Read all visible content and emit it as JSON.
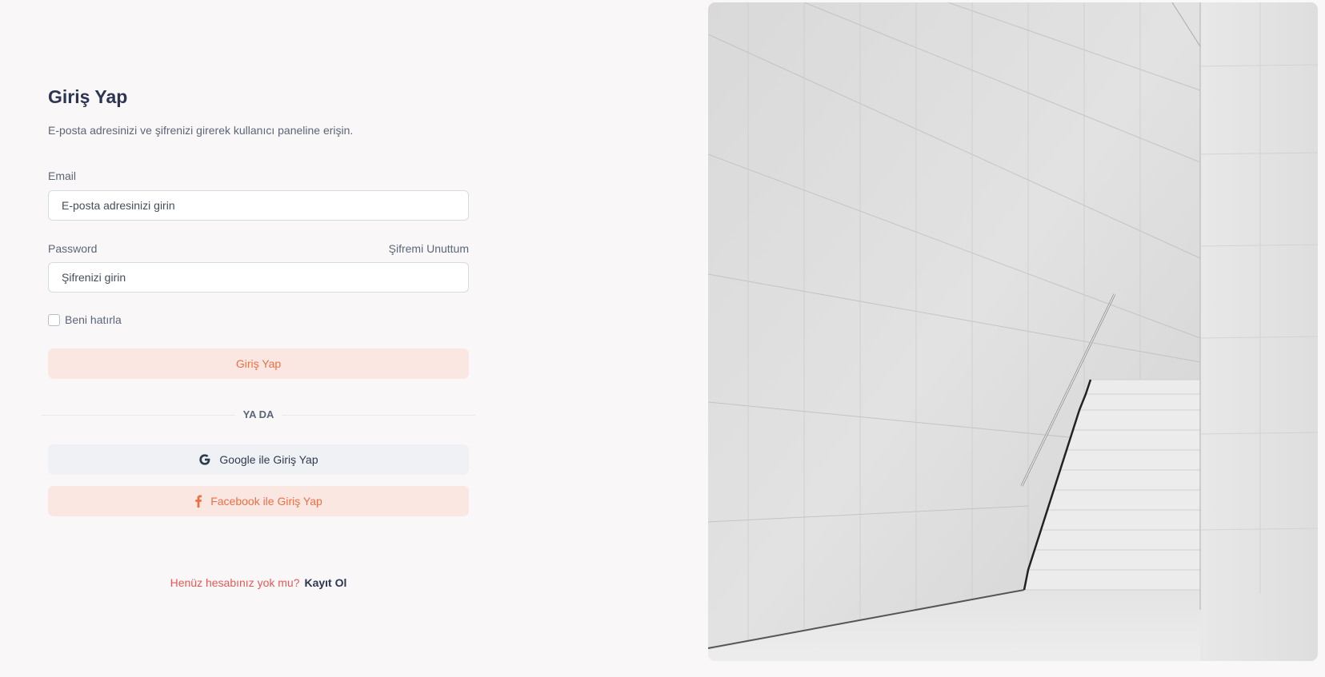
{
  "login": {
    "title": "Giriş Yap",
    "subtitle": "E-posta adresinizi ve şifrenizi girerek kullanıcı paneline erişin.",
    "email": {
      "label": "Email",
      "placeholder": "E-posta adresinizi girin",
      "value": ""
    },
    "password": {
      "label": "Password",
      "placeholder": "Şifrenizi girin",
      "value": "",
      "forgot_label": "Şifremi Unuttum"
    },
    "remember_label": "Beni hatırla",
    "remember_checked": false,
    "submit_label": "Giriş Yap",
    "divider_text": "YA DA",
    "google_label": "Google ile Giriş Yap",
    "facebook_label": "Facebook ile Giriş Yap",
    "signup_question": "Henüz hesabınız yok mu?",
    "signup_link": "Kayıt Ol"
  },
  "icons": {
    "google": "google-icon",
    "facebook": "facebook-icon"
  },
  "colors": {
    "accent": "#ee6f44",
    "accent_bg": "#fbe7e1",
    "heading": "#2c3553",
    "signup_question": "#e25b57"
  }
}
